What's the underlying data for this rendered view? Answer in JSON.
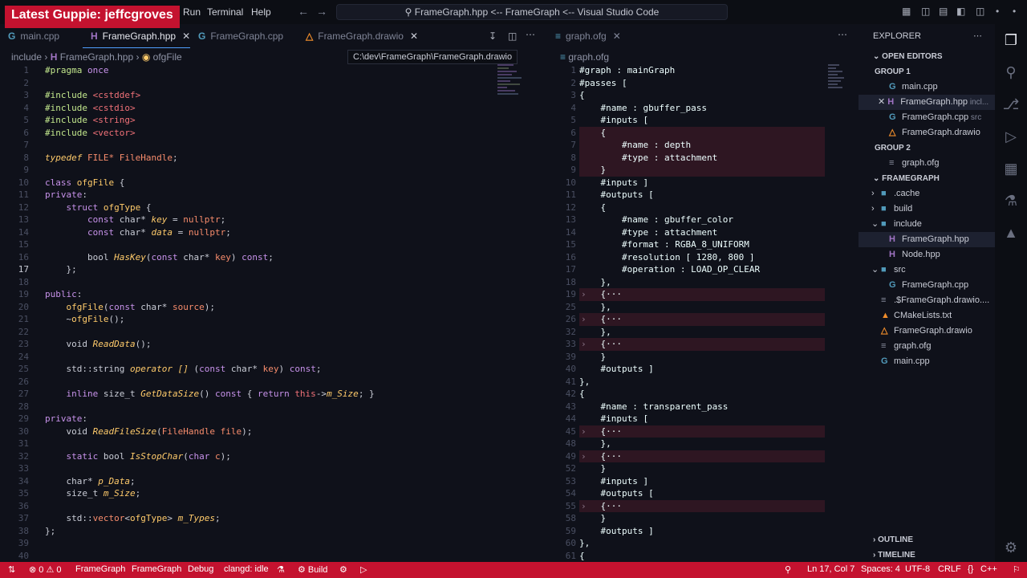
{
  "overlay": {
    "text": "Latest Guppie: jeffcgroves"
  },
  "titlebar": {
    "menu_partial": "Run",
    "menu_terminal": "Terminal",
    "menu_help": "Help",
    "command_center": "FrameGraph.hpp <-- FrameGraph <-- Visual Studio Code"
  },
  "left_tabs": [
    {
      "label": "main.cpp",
      "icon": "cpp-icon"
    },
    {
      "label": "FrameGraph.hpp",
      "icon": "h-icon"
    },
    {
      "label": "FrameGraph.cpp",
      "icon": "cpp-icon"
    },
    {
      "label": "FrameGraph.drawio",
      "icon": "drawio-icon"
    }
  ],
  "right_tabs": [
    {
      "label": "graph.ofg"
    }
  ],
  "left_breadcrumb": {
    "folder": "include",
    "file": "FrameGraph.hpp",
    "symbol": "ofgFile"
  },
  "right_breadcrumb": {
    "file": "graph.ofg"
  },
  "tooltip": "C:\\dev\\FrameGraph\\FrameGraph.drawio",
  "left_code": [
    {
      "n": "1",
      "t": [
        [
          "c-pp",
          "#pragma "
        ],
        [
          "c-kw",
          "once"
        ]
      ]
    },
    {
      "n": "2",
      "t": []
    },
    {
      "n": "3",
      "t": [
        [
          "c-pp",
          "#include "
        ],
        [
          "c-inc",
          "<cstddef>"
        ]
      ]
    },
    {
      "n": "4",
      "t": [
        [
          "c-pp",
          "#include "
        ],
        [
          "c-inc",
          "<cstdio>"
        ]
      ]
    },
    {
      "n": "5",
      "t": [
        [
          "c-pp",
          "#include "
        ],
        [
          "c-inc",
          "<string>"
        ]
      ]
    },
    {
      "n": "6",
      "t": [
        [
          "c-pp",
          "#include "
        ],
        [
          "c-inc",
          "<vector>"
        ]
      ]
    },
    {
      "n": "7",
      "t": []
    },
    {
      "n": "8",
      "t": [
        [
          "c-it",
          "typedef "
        ],
        [
          "c-var",
          "FILE* "
        ],
        [
          "c-var",
          "FileHandle"
        ],
        [
          "c-plain",
          ";"
        ]
      ]
    },
    {
      "n": "9",
      "t": []
    },
    {
      "n": "10",
      "t": [
        [
          "c-kw",
          "class "
        ],
        [
          "c-type",
          "ofgFile "
        ],
        [
          "c-plain",
          "{"
        ]
      ]
    },
    {
      "n": "11",
      "t": [
        [
          "c-kw",
          "private"
        ],
        [
          "c-plain",
          ":"
        ]
      ]
    },
    {
      "n": "12",
      "t": [
        [
          "c-plain",
          "    "
        ],
        [
          "c-kw",
          "struct "
        ],
        [
          "c-type",
          "ofgType "
        ],
        [
          "c-plain",
          "{"
        ]
      ]
    },
    {
      "n": "13",
      "t": [
        [
          "c-plain",
          "        "
        ],
        [
          "c-kw",
          "const "
        ],
        [
          "c-plain",
          "char* "
        ],
        [
          "c-it",
          "key"
        ],
        [
          "c-plain",
          " = "
        ],
        [
          "c-var",
          "nullptr"
        ],
        [
          "c-plain",
          ";"
        ]
      ]
    },
    {
      "n": "14",
      "t": [
        [
          "c-plain",
          "        "
        ],
        [
          "c-kw",
          "const "
        ],
        [
          "c-plain",
          "char* "
        ],
        [
          "c-it",
          "data"
        ],
        [
          "c-plain",
          " = "
        ],
        [
          "c-var",
          "nullptr"
        ],
        [
          "c-plain",
          ";"
        ]
      ]
    },
    {
      "n": "15",
      "t": []
    },
    {
      "n": "16",
      "t": [
        [
          "c-plain",
          "        bool "
        ],
        [
          "c-it",
          "HasKey"
        ],
        [
          "c-plain",
          "("
        ],
        [
          "c-kw",
          "const "
        ],
        [
          "c-plain",
          "char* "
        ],
        [
          "c-var",
          "key"
        ],
        [
          "c-plain",
          ") "
        ],
        [
          "c-kw",
          "const"
        ],
        [
          "c-plain",
          ";"
        ]
      ]
    },
    {
      "n": "17",
      "t": [
        [
          "c-plain",
          "    };"
        ]
      ]
    },
    {
      "n": "18",
      "t": []
    },
    {
      "n": "19",
      "t": [
        [
          "c-kw",
          "public"
        ],
        [
          "c-plain",
          ":"
        ]
      ]
    },
    {
      "n": "20",
      "t": [
        [
          "c-plain",
          "    "
        ],
        [
          "c-type",
          "ofgFile"
        ],
        [
          "c-plain",
          "("
        ],
        [
          "c-kw",
          "const "
        ],
        [
          "c-plain",
          "char* "
        ],
        [
          "c-var",
          "source"
        ],
        [
          "c-plain",
          ");"
        ]
      ]
    },
    {
      "n": "21",
      "t": [
        [
          "c-plain",
          "    ~"
        ],
        [
          "c-type",
          "ofgFile"
        ],
        [
          "c-plain",
          "();"
        ]
      ]
    },
    {
      "n": "22",
      "t": []
    },
    {
      "n": "23",
      "t": [
        [
          "c-plain",
          "    void "
        ],
        [
          "c-it",
          "ReadData"
        ],
        [
          "c-plain",
          "();"
        ]
      ]
    },
    {
      "n": "24",
      "t": []
    },
    {
      "n": "25",
      "t": [
        [
          "c-plain",
          "    std::string "
        ],
        [
          "c-it",
          "operator []"
        ],
        [
          "c-plain",
          " ("
        ],
        [
          "c-kw",
          "const "
        ],
        [
          "c-plain",
          "char* "
        ],
        [
          "c-var",
          "key"
        ],
        [
          "c-plain",
          ") "
        ],
        [
          "c-kw",
          "const"
        ],
        [
          "c-plain",
          ";"
        ]
      ]
    },
    {
      "n": "26",
      "t": []
    },
    {
      "n": "27",
      "t": [
        [
          "c-plain",
          "    "
        ],
        [
          "c-kw",
          "inline "
        ],
        [
          "c-plain",
          "size_t "
        ],
        [
          "c-it",
          "GetDataSize"
        ],
        [
          "c-plain",
          "() "
        ],
        [
          "c-kw",
          "const "
        ],
        [
          "c-plain",
          "{ "
        ],
        [
          "c-kw",
          "return "
        ],
        [
          "c-inc",
          "this"
        ],
        [
          "c-plain",
          "->"
        ],
        [
          "c-it",
          "m_Size"
        ],
        [
          "c-plain",
          "; }"
        ]
      ]
    },
    {
      "n": "28",
      "t": []
    },
    {
      "n": "29",
      "t": [
        [
          "c-kw",
          "private"
        ],
        [
          "c-plain",
          ":"
        ]
      ]
    },
    {
      "n": "30",
      "t": [
        [
          "c-plain",
          "    void "
        ],
        [
          "c-it",
          "ReadFileSize"
        ],
        [
          "c-plain",
          "("
        ],
        [
          "c-var",
          "FileHandle "
        ],
        [
          "c-var",
          "file"
        ],
        [
          "c-plain",
          ");"
        ]
      ]
    },
    {
      "n": "31",
      "t": []
    },
    {
      "n": "32",
      "t": [
        [
          "c-plain",
          "    "
        ],
        [
          "c-kw",
          "static "
        ],
        [
          "c-plain",
          "bool "
        ],
        [
          "c-it",
          "IsStopChar"
        ],
        [
          "c-plain",
          "("
        ],
        [
          "c-kw",
          "char "
        ],
        [
          "c-var",
          "c"
        ],
        [
          "c-plain",
          ");"
        ]
      ]
    },
    {
      "n": "33",
      "t": []
    },
    {
      "n": "34",
      "t": [
        [
          "c-plain",
          "    char* "
        ],
        [
          "c-it",
          "p_Data"
        ],
        [
          "c-plain",
          ";"
        ]
      ]
    },
    {
      "n": "35",
      "t": [
        [
          "c-plain",
          "    size_t "
        ],
        [
          "c-it",
          "m_Size"
        ],
        [
          "c-plain",
          ";"
        ]
      ]
    },
    {
      "n": "36",
      "t": []
    },
    {
      "n": "37",
      "t": [
        [
          "c-plain",
          "    std::"
        ],
        [
          "c-var",
          "vector"
        ],
        [
          "c-plain",
          "<"
        ],
        [
          "c-type",
          "ofgType"
        ],
        [
          "c-plain",
          "> "
        ],
        [
          "c-it",
          "m_Types"
        ],
        [
          "c-plain",
          ";"
        ]
      ]
    },
    {
      "n": "38",
      "t": [
        [
          "c-plain",
          "};"
        ]
      ]
    },
    {
      "n": "39",
      "t": []
    },
    {
      "n": "40",
      "t": []
    }
  ],
  "right_code": [
    {
      "n": "1",
      "t": "#graph : mainGraph",
      "f": false
    },
    {
      "n": "2",
      "t": "#passes [",
      "f": false
    },
    {
      "n": "3",
      "t": "{",
      "f": false
    },
    {
      "n": "4",
      "t": "    #name : gbuffer_pass",
      "f": false
    },
    {
      "n": "5",
      "t": "    #inputs [",
      "f": false
    },
    {
      "n": "6",
      "t": "    {",
      "f": false,
      "hl": true
    },
    {
      "n": "7",
      "t": "        #name : depth",
      "f": false,
      "hl": true
    },
    {
      "n": "8",
      "t": "        #type : attachment",
      "f": false,
      "hl": true
    },
    {
      "n": "9",
      "t": "    }",
      "f": false,
      "hl": true
    },
    {
      "n": "10",
      "t": "    #inputs ]",
      "f": false
    },
    {
      "n": "11",
      "t": "    #outputs [",
      "f": false
    },
    {
      "n": "12",
      "t": "    {",
      "f": false
    },
    {
      "n": "13",
      "t": "        #name : gbuffer_color",
      "f": false
    },
    {
      "n": "14",
      "t": "        #type : attachment",
      "f": false
    },
    {
      "n": "15",
      "t": "        #format : RGBA_8_UNIFORM",
      "f": false
    },
    {
      "n": "16",
      "t": "        #resolution [ 1280, 800 ]",
      "f": false
    },
    {
      "n": "17",
      "t": "        #operation : LOAD_OP_CLEAR",
      "f": false
    },
    {
      "n": "18",
      "t": "    },",
      "f": false
    },
    {
      "n": "19",
      "t": "    {···",
      "f": true
    },
    {
      "n": "25",
      "t": "    },",
      "f": false
    },
    {
      "n": "26",
      "t": "    {···",
      "f": true
    },
    {
      "n": "32",
      "t": "    },",
      "f": false
    },
    {
      "n": "33",
      "t": "    {···",
      "f": true
    },
    {
      "n": "39",
      "t": "    }",
      "f": false
    },
    {
      "n": "40",
      "t": "    #outputs ]",
      "f": false
    },
    {
      "n": "41",
      "t": "},",
      "f": false
    },
    {
      "n": "42",
      "t": "{",
      "f": false
    },
    {
      "n": "43",
      "t": "    #name : transparent_pass",
      "f": false
    },
    {
      "n": "44",
      "t": "    #inputs [",
      "f": false
    },
    {
      "n": "45",
      "t": "    {···",
      "f": true
    },
    {
      "n": "48",
      "t": "    },",
      "f": false
    },
    {
      "n": "49",
      "t": "    {···",
      "f": true
    },
    {
      "n": "52",
      "t": "    }",
      "f": false
    },
    {
      "n": "53",
      "t": "    #inputs ]",
      "f": false
    },
    {
      "n": "54",
      "t": "    #outputs [",
      "f": false
    },
    {
      "n": "55",
      "t": "    {···",
      "f": true
    },
    {
      "n": "58",
      "t": "    }",
      "f": false
    },
    {
      "n": "59",
      "t": "    #outputs ]",
      "f": false
    },
    {
      "n": "60",
      "t": "},",
      "f": false
    },
    {
      "n": "61",
      "t": "{",
      "f": false
    }
  ],
  "explorer": {
    "title": "EXPLORER",
    "open_editors": "OPEN EDITORS",
    "group1": "GROUP 1",
    "group1_items": [
      {
        "label": "main.cpp",
        "icon": "cpp-icon",
        "hint": "",
        "sel": false,
        "x": false
      },
      {
        "label": "FrameGraph.hpp",
        "icon": "h-icon",
        "hint": "incl...",
        "sel": true,
        "x": true
      },
      {
        "label": "FrameGraph.cpp",
        "icon": "cpp-icon",
        "hint": "src",
        "sel": false,
        "x": false
      },
      {
        "label": "FrameGraph.drawio",
        "icon": "drawio-icon",
        "hint": "",
        "sel": false,
        "x": false
      }
    ],
    "group2": "GROUP 2",
    "group2_items": [
      {
        "label": "graph.ofg",
        "icon": "file-icon"
      }
    ],
    "project": "FRAMEGRAPH",
    "tree": [
      {
        "label": ".cache",
        "icon": "folder-icon",
        "indent": 1,
        "caret": "closed"
      },
      {
        "label": "build",
        "icon": "folder-icon",
        "indent": 1,
        "caret": "closed"
      },
      {
        "label": "include",
        "icon": "folder-icon",
        "indent": 1,
        "caret": "open"
      },
      {
        "label": "FrameGraph.hpp",
        "icon": "h-icon",
        "indent": 2,
        "caret": "",
        "sel": true
      },
      {
        "label": "Node.hpp",
        "icon": "h-icon",
        "indent": 2,
        "caret": ""
      },
      {
        "label": "src",
        "icon": "folder-icon",
        "indent": 1,
        "caret": "open"
      },
      {
        "label": "FrameGraph.cpp",
        "icon": "cpp-icon",
        "indent": 2,
        "caret": ""
      },
      {
        "label": ".$FrameGraph.drawio....",
        "icon": "file-icon",
        "indent": 1,
        "caret": ""
      },
      {
        "label": "CMakeLists.txt",
        "icon": "cmake-icon",
        "indent": 1,
        "caret": ""
      },
      {
        "label": "FrameGraph.drawio",
        "icon": "drawio-icon",
        "indent": 1,
        "caret": ""
      },
      {
        "label": "graph.ofg",
        "icon": "file-icon",
        "indent": 1,
        "caret": ""
      },
      {
        "label": "main.cpp",
        "icon": "cpp-icon",
        "indent": 1,
        "caret": ""
      }
    ],
    "outline": "OUTLINE",
    "timeline": "TIMELINE"
  },
  "statusbar": {
    "errors": "0",
    "warnings": "0",
    "project": "FrameGraph",
    "target": "FrameGraph",
    "config": "Debug",
    "clangd": "clangd: idle",
    "build": "Build",
    "position": "Ln 17, Col 7",
    "spaces": "Spaces: 4",
    "encoding": "UTF-8",
    "eol": "CRLF",
    "lang_braces": "{}",
    "language": "C++"
  }
}
